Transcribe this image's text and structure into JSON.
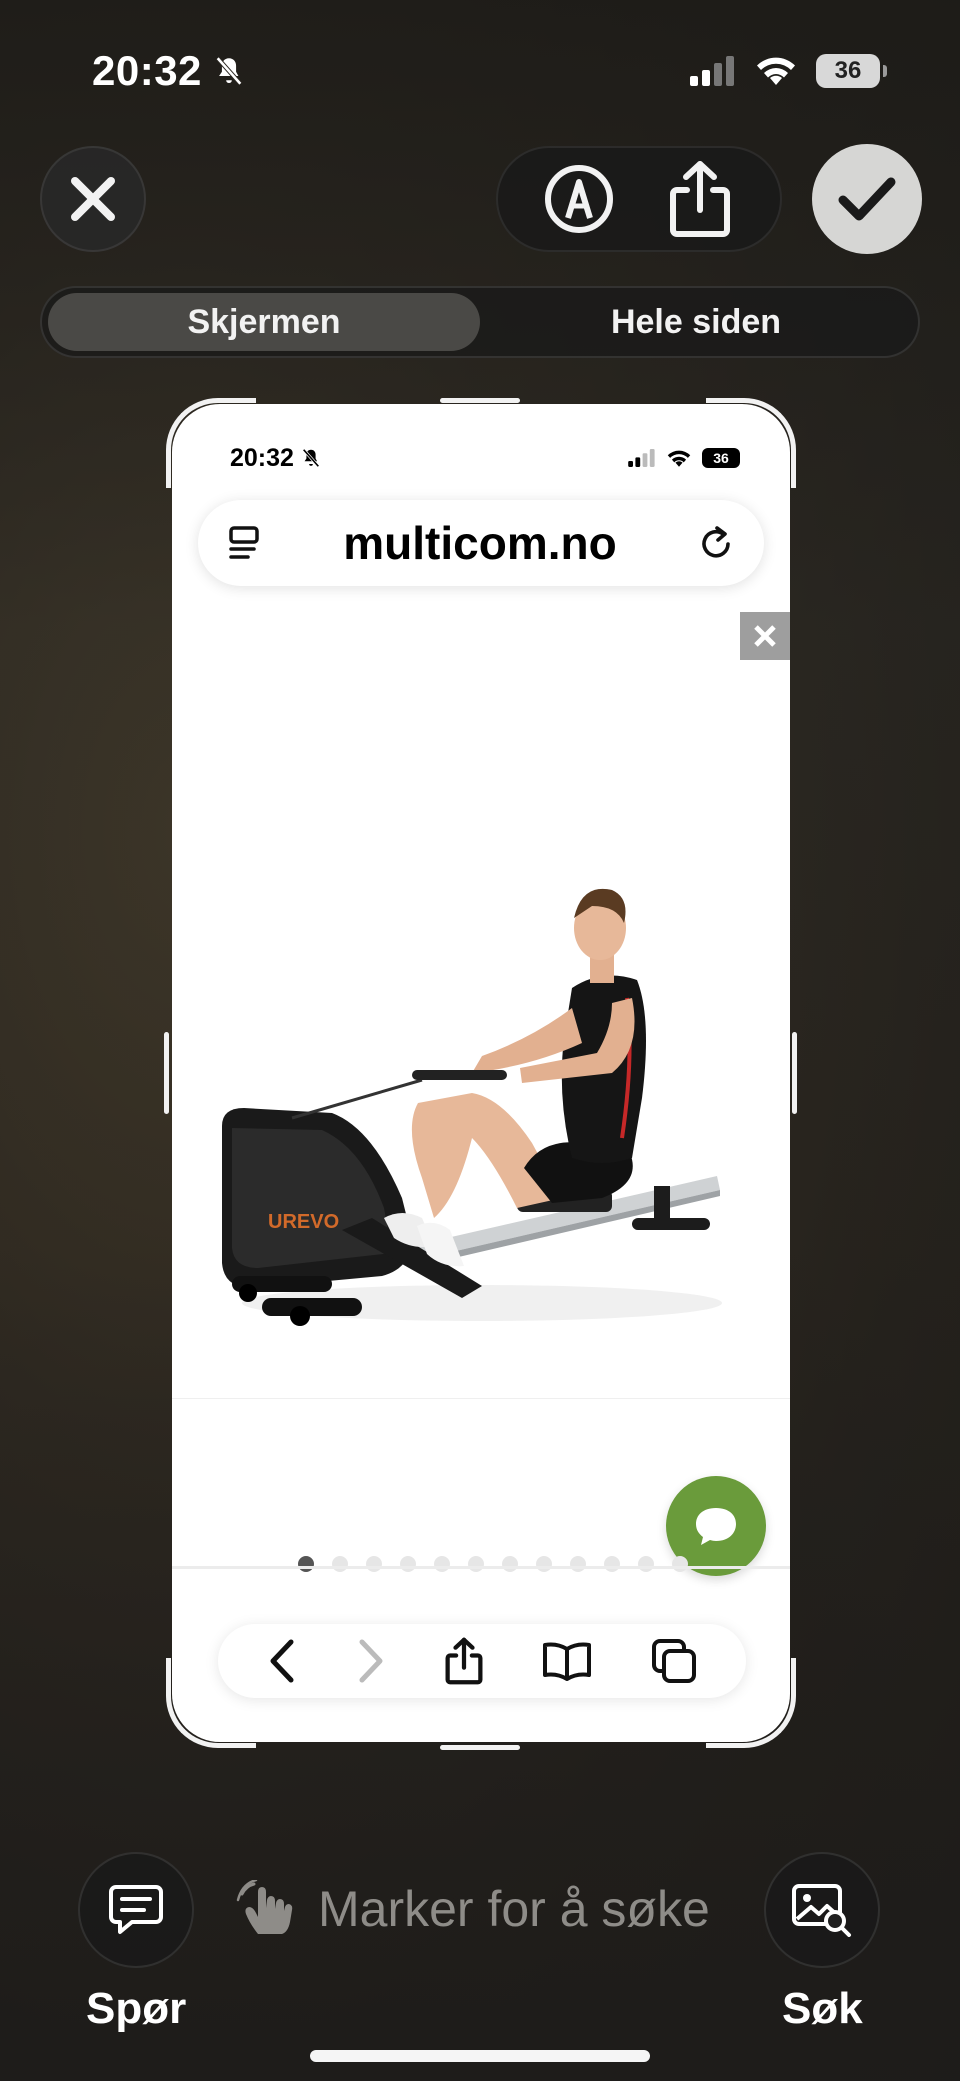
{
  "status_bar": {
    "time": "20:32",
    "battery": "36"
  },
  "toolbar": {
    "close": "close",
    "markup": "markup",
    "share": "share",
    "done": "done"
  },
  "segment": {
    "items": [
      "Skjermen",
      "Hele siden"
    ],
    "active_index": 0
  },
  "preview": {
    "status_bar": {
      "time": "20:32",
      "battery": "36"
    },
    "url": "multicom.no",
    "product_image": {
      "brand": "UREVO"
    },
    "carousel": {
      "total": 12,
      "active": 0
    },
    "colors": {
      "chat": "#6a9b3b"
    }
  },
  "bottom": {
    "ask_label": "Spør",
    "search_label": "Søk",
    "hint": "Marker for å søke"
  }
}
